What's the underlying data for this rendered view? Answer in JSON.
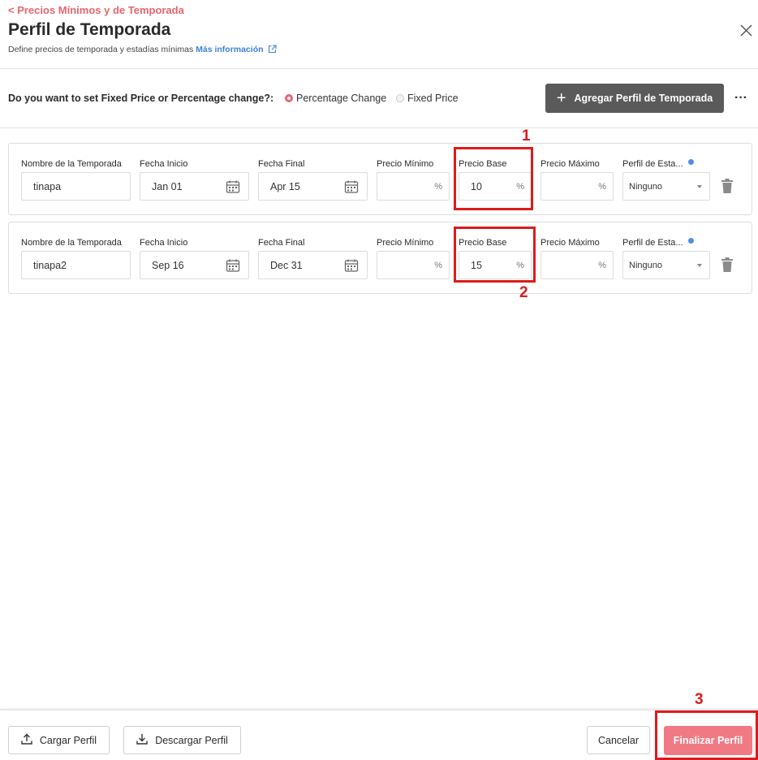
{
  "header": {
    "back_link": "< Precios Mínimos y de Temporada",
    "title": "Perfil de Temporada",
    "subtitle": "Define precios de temporada y estadías mínimas",
    "more_info": "Más información"
  },
  "toolbar": {
    "question": "Do you want to set Fixed Price or Percentage change?:",
    "options": [
      {
        "label": "Percentage Change",
        "selected": true
      },
      {
        "label": "Fixed Price",
        "selected": false
      }
    ],
    "add_button": "Agregar Perfil de Temporada"
  },
  "columns": {
    "name": "Nombre de la Temporada",
    "start": "Fecha Inicio",
    "end": "Fecha Final",
    "min_price": "Precio Mínimo",
    "base_price": "Precio Base",
    "max_price": "Precio Máximo",
    "stay_profile": "Perfil de Esta..."
  },
  "rows": [
    {
      "name": "tinapa",
      "start": "Jan 01",
      "end": "Apr 15",
      "min": "",
      "base": "10",
      "max": "",
      "unit": "%",
      "profile": "Ninguno"
    },
    {
      "name": "tinapa2",
      "start": "Sep 16",
      "end": "Dec 31",
      "min": "",
      "base": "15",
      "max": "",
      "unit": "%",
      "profile": "Ninguno"
    }
  ],
  "annotations": [
    "1",
    "2",
    "3"
  ],
  "footer": {
    "upload": "Cargar Perfil",
    "download": "Descargar Perfil",
    "cancel": "Cancelar",
    "finalize": "Finalizar Perfil"
  },
  "colors": {
    "accent": "#e8646f",
    "link": "#3b82d6",
    "annotation": "#dd1b1b",
    "add_button": "#5a5a5a",
    "finalize": "#f07a84"
  },
  "icons": [
    "external-link-icon",
    "close-icon",
    "plus-icon",
    "more-icon",
    "calendar-icon",
    "info-icon",
    "trash-icon",
    "upload-icon",
    "download-icon"
  ]
}
